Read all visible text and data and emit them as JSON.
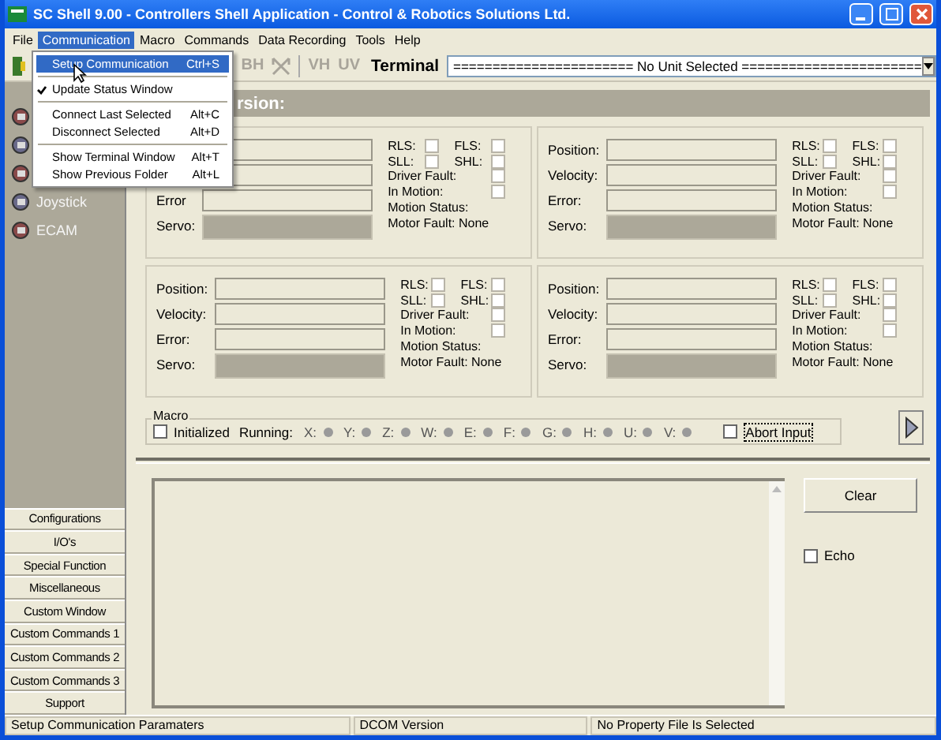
{
  "window": {
    "title": "SC Shell 9.00 - Controllers Shell Application - Control & Robotics Solutions Ltd."
  },
  "menu_bar": [
    {
      "label": "File",
      "selected": false
    },
    {
      "label": "Communication",
      "selected": true
    },
    {
      "label": "Macro",
      "selected": false
    },
    {
      "label": "Commands",
      "selected": false
    },
    {
      "label": "Data Recording",
      "selected": false
    },
    {
      "label": "Tools",
      "selected": false
    },
    {
      "label": "Help",
      "selected": false
    }
  ],
  "open_menu": [
    {
      "kind": "item",
      "label": "Setup Communication",
      "shortcut": "Ctrl+S",
      "selected": true,
      "checked": false
    },
    {
      "kind": "separator"
    },
    {
      "kind": "item",
      "label": "Update Status Window",
      "selected": false,
      "checked": true
    },
    {
      "kind": "separator"
    },
    {
      "kind": "item",
      "label": "Connect Last Selected",
      "shortcut": "Alt+C",
      "selected": false,
      "checked": false
    },
    {
      "kind": "item",
      "label": "Disconnect Selected",
      "shortcut": "Alt+D",
      "selected": false,
      "checked": false
    },
    {
      "kind": "separator"
    },
    {
      "kind": "item",
      "label": "Show Terminal Window",
      "shortcut": "Alt+T",
      "selected": false,
      "checked": false
    },
    {
      "kind": "item",
      "label": "Show Previous Folder",
      "shortcut": "Alt+L",
      "selected": false,
      "checked": false
    }
  ],
  "toolbar": {
    "buttons": [
      {
        "kind": "text",
        "label": "BH",
        "disabled": true
      },
      {
        "kind": "icon",
        "disabled": true
      },
      {
        "kind": "separator"
      },
      {
        "kind": "text",
        "label": "VH",
        "disabled": true
      },
      {
        "kind": "text",
        "label": "UV",
        "disabled": true
      }
    ],
    "terminal_label": "Terminal",
    "unit_select": "======================= No Unit Selected ======================="
  },
  "header": "rsion:",
  "sidebar": {
    "nav": [
      {
        "kind": "icon"
      },
      {
        "kind": "icon"
      },
      {
        "kind": "icon"
      },
      {
        "kind": "labeled",
        "label": "Joystick"
      },
      {
        "kind": "labeled",
        "label": "ECAM"
      }
    ],
    "buttons": [
      "Configurations",
      "I/O's",
      "Special Function",
      "Miscellaneous",
      "Custom Window",
      "Custom Commands 1",
      "Custom Commands 2",
      "Custom Commands 3",
      "Support"
    ]
  },
  "axes": [
    {
      "fields": [
        {
          "kind": "text"
        },
        {
          "kind": "text"
        },
        {
          "kind": "text",
          "label": "Error"
        },
        {
          "kind": "servo",
          "label": "Servo:"
        }
      ],
      "flags": [
        {
          "label": "RLS:",
          "checked": false
        },
        {
          "label": "FLS:",
          "checked": false
        },
        {
          "label": "SLL:",
          "checked": false
        },
        {
          "label": "SHL:",
          "checked": false
        },
        {
          "label": "Driver Fault:",
          "checked": false
        },
        {
          "label": "In Motion:",
          "checked": false
        }
      ],
      "motion_status": "Motion Status:",
      "motor_fault": "Motor Fault: None"
    },
    {
      "fields": [
        {
          "kind": "text",
          "label": "Position:"
        },
        {
          "kind": "text",
          "label": "Velocity:"
        },
        {
          "kind": "text",
          "label": "Error:"
        },
        {
          "kind": "servo",
          "label": "Servo:"
        }
      ],
      "flags": [
        {
          "label": "RLS:",
          "checked": false
        },
        {
          "label": "FLS:",
          "checked": false
        },
        {
          "label": "SLL:",
          "checked": false
        },
        {
          "label": "SHL:",
          "checked": false
        },
        {
          "label": "Driver Fault:",
          "checked": false
        },
        {
          "label": "In Motion:",
          "checked": false
        }
      ],
      "motion_status": "Motion Status:",
      "motor_fault": "Motor Fault: None"
    },
    {
      "fields": [
        {
          "kind": "text",
          "label": "Position:"
        },
        {
          "kind": "text",
          "label": "Velocity:"
        },
        {
          "kind": "text",
          "label": "Error:"
        },
        {
          "kind": "servo",
          "label": "Servo:"
        }
      ],
      "flags": [
        {
          "label": "RLS:",
          "checked": false
        },
        {
          "label": "FLS:",
          "checked": false
        },
        {
          "label": "SLL:",
          "checked": false
        },
        {
          "label": "SHL:",
          "checked": false
        },
        {
          "label": "Driver Fault:",
          "checked": false
        },
        {
          "label": "In Motion:",
          "checked": false
        }
      ],
      "motion_status": "Motion Status:",
      "motor_fault": "Motor Fault: None"
    },
    {
      "fields": [
        {
          "kind": "text",
          "label": "Position:"
        },
        {
          "kind": "text",
          "label": "Velocity:"
        },
        {
          "kind": "text",
          "label": "Error:"
        },
        {
          "kind": "servo",
          "label": "Servo:"
        }
      ],
      "flags": [
        {
          "label": "RLS:",
          "checked": false
        },
        {
          "label": "FLS:",
          "checked": false
        },
        {
          "label": "SLL:",
          "checked": false
        },
        {
          "label": "SHL:",
          "checked": false
        },
        {
          "label": "Driver Fault:",
          "checked": false
        },
        {
          "label": "In Motion:",
          "checked": false
        }
      ],
      "motion_status": "Motion Status:",
      "motor_fault": "Motor Fault: None"
    }
  ],
  "macro": {
    "legend": "Macro",
    "initialized": {
      "label": "Initialized",
      "checked": false
    },
    "running_label": "Running:",
    "axes": [
      {
        "label": "X:",
        "on": false
      },
      {
        "label": "Y:",
        "on": false
      },
      {
        "label": "Z:",
        "on": false
      },
      {
        "label": "W:",
        "on": false
      },
      {
        "label": "E:",
        "on": false
      },
      {
        "label": "F:",
        "on": false
      },
      {
        "label": "G:",
        "on": false
      },
      {
        "label": "H:",
        "on": false
      },
      {
        "label": "U:",
        "on": false
      },
      {
        "label": "V:",
        "on": false
      }
    ],
    "abort": {
      "label": "Abort Input",
      "checked": false
    }
  },
  "terminal": {
    "clear": "Clear",
    "echo": {
      "label": "Echo",
      "checked": false
    }
  },
  "status_bar": [
    "Setup Communication Paramaters",
    "DCOM Version",
    "No Property File Is Selected"
  ]
}
